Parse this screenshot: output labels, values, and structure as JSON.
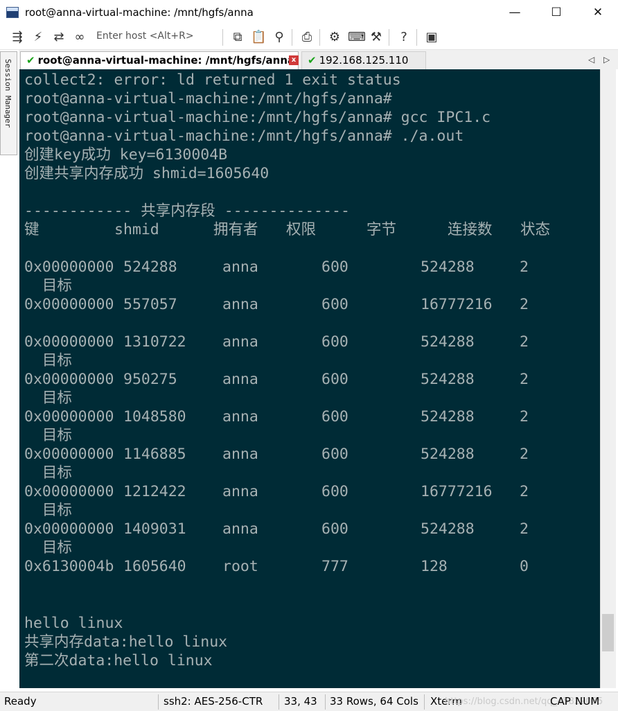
{
  "window": {
    "title": "root@anna-virtual-machine: /mnt/hgfs/anna",
    "minimize_glyph": "—",
    "maximize_glyph": "☐",
    "close_glyph": "✕"
  },
  "toolbar": {
    "host_placeholder": "Enter host <Alt+R>",
    "icons": [
      "connect-icon",
      "quick-connect-icon",
      "reconnect-icon",
      "link-icon",
      "copy-icon",
      "paste-icon",
      "find-icon",
      "print-icon",
      "settings-icon",
      "keymap-icon",
      "tools-icon",
      "help-icon",
      "screenshot-icon"
    ]
  },
  "session_manager": {
    "label": "Session Manager"
  },
  "tabs": [
    {
      "label": "root@anna-virtual-machine: /mnt/hgfs/anna",
      "active": true,
      "close": "x"
    },
    {
      "label": "192.168.125.110",
      "active": false
    }
  ],
  "tab_nav": {
    "prev": "◁",
    "next": "▷"
  },
  "terminal": {
    "colors": {
      "background": "#002b36",
      "foreground": "#a6b1b3"
    },
    "lines": [
      "collect2: error: ld returned 1 exit status",
      "root@anna-virtual-machine:/mnt/hgfs/anna#",
      "root@anna-virtual-machine:/mnt/hgfs/anna# gcc IPC1.c",
      "root@anna-virtual-machine:/mnt/hgfs/anna# ./a.out",
      "创建key成功 key=6130004B",
      "创建共享内存成功 shmid=1605640",
      "",
      "------------ 共享内存段 --------------"
    ],
    "headers": [
      "键",
      "shmid",
      "拥有者",
      "权限",
      "字节",
      "连接数",
      "状态"
    ],
    "rows": [
      {
        "key": "0x00000000",
        "shmid": "524288",
        "owner": "anna",
        "perms": "600",
        "bytes": "524288",
        "nattch": "2",
        "status": "目标"
      },
      {
        "key": "0x00000000",
        "shmid": "557057",
        "owner": "anna",
        "perms": "600",
        "bytes": "16777216",
        "nattch": "2",
        "status": ""
      },
      {
        "key": "0x00000000",
        "shmid": "1310722",
        "owner": "anna",
        "perms": "600",
        "bytes": "524288",
        "nattch": "2",
        "status": "目标"
      },
      {
        "key": "0x00000000",
        "shmid": "950275",
        "owner": "anna",
        "perms": "600",
        "bytes": "524288",
        "nattch": "2",
        "status": "目标"
      },
      {
        "key": "0x00000000",
        "shmid": "1048580",
        "owner": "anna",
        "perms": "600",
        "bytes": "524288",
        "nattch": "2",
        "status": "目标"
      },
      {
        "key": "0x00000000",
        "shmid": "1146885",
        "owner": "anna",
        "perms": "600",
        "bytes": "524288",
        "nattch": "2",
        "status": "目标"
      },
      {
        "key": "0x00000000",
        "shmid": "1212422",
        "owner": "anna",
        "perms": "600",
        "bytes": "16777216",
        "nattch": "2",
        "status": "目标"
      },
      {
        "key": "0x00000000",
        "shmid": "1409031",
        "owner": "anna",
        "perms": "600",
        "bytes": "524288",
        "nattch": "2",
        "status": "目标"
      },
      {
        "key": "0x6130004b",
        "shmid": "1605640",
        "owner": "root",
        "perms": "777",
        "bytes": "128",
        "nattch": "0",
        "status": ""
      }
    ],
    "tail": [
      "hello linux",
      "共享内存data:hello linux",
      "第二次data:hello linux"
    ]
  },
  "statusbar": {
    "ready": "Ready",
    "cipher": "ssh2: AES-256-CTR",
    "position": "33,  43",
    "size": "33 Rows, 64 Cols",
    "emulation": "Xterm",
    "watermark": "https://blog.csdn.net/qq_45829085",
    "caps": "CAP",
    "num": "NUM"
  }
}
